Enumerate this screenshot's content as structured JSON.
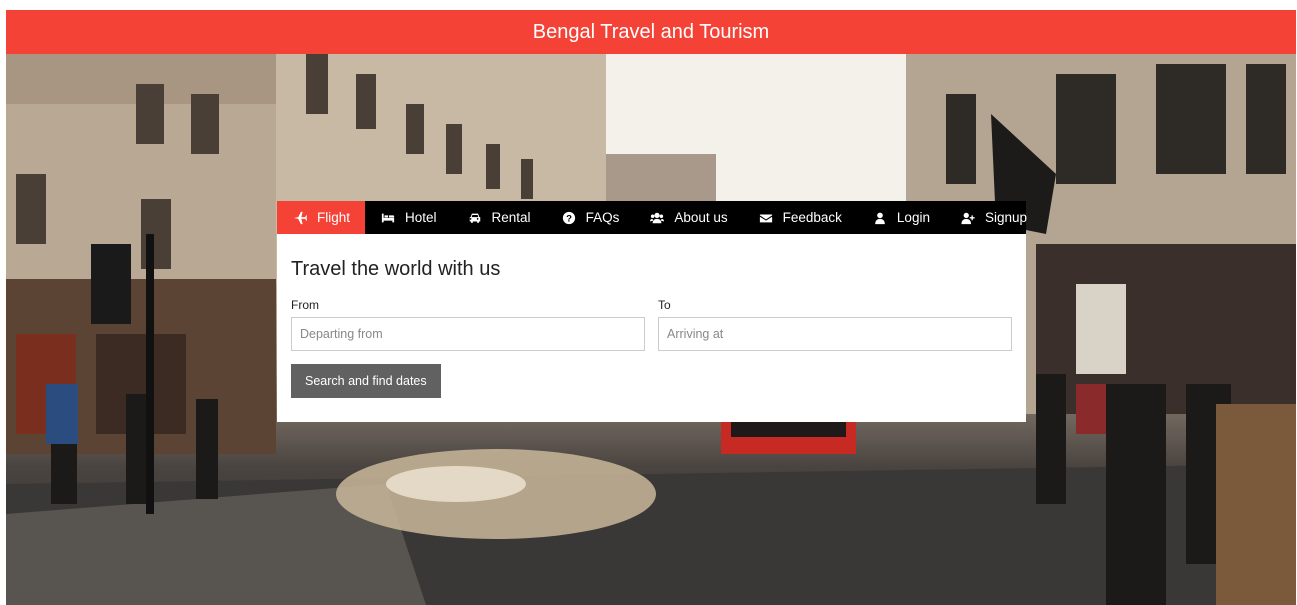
{
  "header": {
    "title": "Bengal Travel and Tourism"
  },
  "nav": {
    "items": [
      {
        "label": "Flight",
        "icon": "plane-icon",
        "active": true
      },
      {
        "label": "Hotel",
        "icon": "bed-icon"
      },
      {
        "label": "Rental",
        "icon": "car-icon"
      },
      {
        "label": "FAQs",
        "icon": "question-icon"
      },
      {
        "label": "About us",
        "icon": "users-icon"
      },
      {
        "label": "Feedback",
        "icon": "envelope-icon"
      },
      {
        "label": "Login",
        "icon": "user-icon"
      },
      {
        "label": "Signup",
        "icon": "user-plus-icon"
      }
    ]
  },
  "form": {
    "title": "Travel the world with us",
    "from_label": "From",
    "from_placeholder": "Departing from",
    "to_label": "To",
    "to_placeholder": "Arriving at",
    "search_label": "Search and find dates"
  },
  "colors": {
    "accent": "#f44336",
    "nav_bg": "#000000",
    "button": "#616161"
  }
}
